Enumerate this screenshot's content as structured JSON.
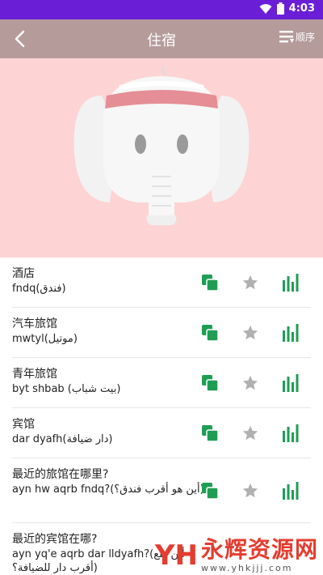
{
  "status_bar": {
    "time": "4:03",
    "bg_color": "#6a1fd6"
  },
  "header": {
    "title": "住宿",
    "order_label": "顺序",
    "bg_color": "#b69b9b"
  },
  "hero": {
    "bg_color": "#fdd3d3",
    "image": "elephant-mascot"
  },
  "phrases": [
    {
      "cn": "酒店",
      "translit": "fndq(فندق)"
    },
    {
      "cn": "汽车旅馆",
      "translit": "mwtyl(موتيل)"
    },
    {
      "cn": "青年旅馆",
      "translit": "byt shbab (بيت شباب)"
    },
    {
      "cn": "宾馆",
      "translit": "dar dyafh(دار ضيافة)"
    },
    {
      "cn": "最近的旅馆在哪里?",
      "translit": "ayn hw aqrb fndq?(أين هو أقرب فندق؟)"
    },
    {
      "cn": "最近的宾馆在哪?",
      "translit": "ayn yq'e aqrb dar lldyafh?(أين يقع أقرب دار للضيافة؟)"
    }
  ],
  "icons": {
    "copy": "copy-icon",
    "star": "star-icon",
    "stats": "bar-chart-icon"
  },
  "colors": {
    "accent_green": "#1f9d55",
    "star_gray": "#b0b0b0"
  },
  "watermark": {
    "logo": "YH",
    "title": "永辉资源网",
    "url": "www.yhkjjj.com"
  }
}
